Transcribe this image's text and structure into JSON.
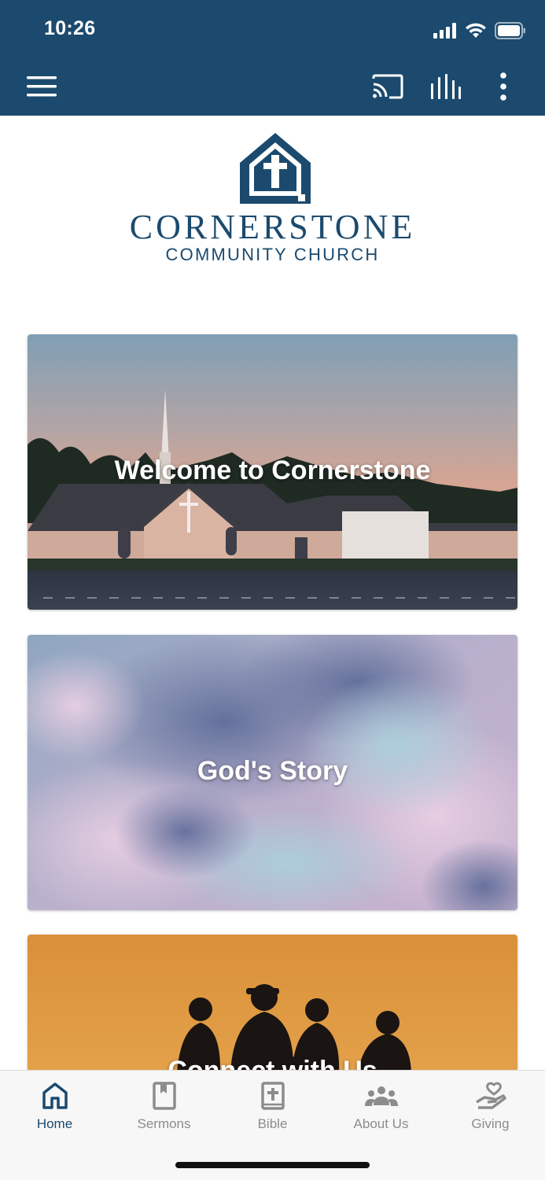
{
  "status_bar": {
    "time": "10:26"
  },
  "app_bar": {
    "icons": [
      "menu-icon",
      "cast-icon",
      "audio-bars-icon",
      "more-vert-icon"
    ],
    "color": "#1b4a6e"
  },
  "logo": {
    "line1": "CORNERSTONE",
    "line2": "COMMUNITY CHURCH"
  },
  "cards": [
    {
      "title": "Welcome to Cornerstone"
    },
    {
      "title": "God's Story"
    },
    {
      "title": "Connect with Us"
    }
  ],
  "bottom_nav": {
    "items": [
      {
        "label": "Home",
        "icon": "home-icon",
        "active": true
      },
      {
        "label": "Sermons",
        "icon": "book-icon",
        "active": false
      },
      {
        "label": "Bible",
        "icon": "bible-icon",
        "active": false
      },
      {
        "label": "About Us",
        "icon": "people-icon",
        "active": false
      },
      {
        "label": "Giving",
        "icon": "giving-hand-icon",
        "active": false
      }
    ],
    "active_color": "#1b4a6e",
    "inactive_color": "#8c8c8c"
  }
}
